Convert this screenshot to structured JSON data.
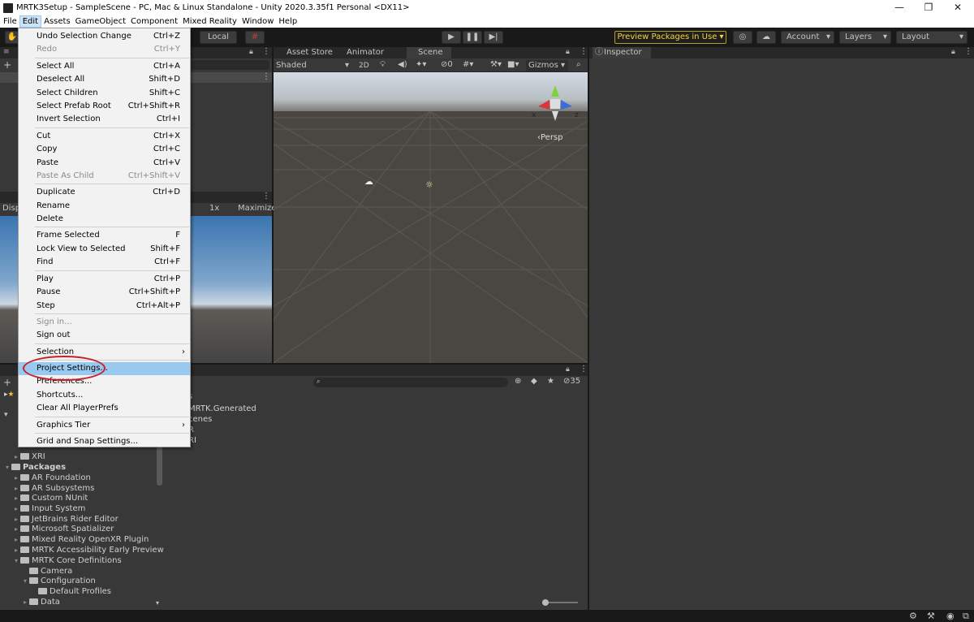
{
  "window": {
    "title": "MRTK3Setup - SampleScene - PC, Mac & Linux Standalone - Unity 2020.3.35f1 Personal <DX11>",
    "controls": [
      "—",
      "❐",
      "✕"
    ]
  },
  "menubar": [
    "File",
    "Edit",
    "Assets",
    "GameObject",
    "Component",
    "Mixed Reality",
    "Window",
    "Help"
  ],
  "toolbar": {
    "pivot_label": "Local",
    "preview_packages": "Preview Packages in Use ▾",
    "account": "Account",
    "layers": "Layers",
    "layout": "Layout"
  },
  "edit_menu": {
    "items": [
      {
        "label": "Undo Selection Change",
        "shortcut": "Ctrl+Z"
      },
      {
        "label": "Redo",
        "shortcut": "Ctrl+Y",
        "disabled": true
      },
      {
        "label": "Select All",
        "shortcut": "Ctrl+A"
      },
      {
        "label": "Deselect All",
        "shortcut": "Shift+D"
      },
      {
        "label": "Select Children",
        "shortcut": "Shift+C"
      },
      {
        "label": "Select Prefab Root",
        "shortcut": "Ctrl+Shift+R"
      },
      {
        "label": "Invert Selection",
        "shortcut": "Ctrl+I"
      },
      {
        "label": "Cut",
        "shortcut": "Ctrl+X"
      },
      {
        "label": "Copy",
        "shortcut": "Ctrl+C"
      },
      {
        "label": "Paste",
        "shortcut": "Ctrl+V"
      },
      {
        "label": "Paste As Child",
        "shortcut": "Ctrl+Shift+V",
        "disabled": true
      },
      {
        "label": "Duplicate",
        "shortcut": "Ctrl+D"
      },
      {
        "label": "Rename",
        "shortcut": ""
      },
      {
        "label": "Delete",
        "shortcut": ""
      },
      {
        "label": "Frame Selected",
        "shortcut": "F"
      },
      {
        "label": "Lock View to Selected",
        "shortcut": "Shift+F"
      },
      {
        "label": "Find",
        "shortcut": "Ctrl+F"
      },
      {
        "label": "Play",
        "shortcut": "Ctrl+P"
      },
      {
        "label": "Pause",
        "shortcut": "Ctrl+Shift+P"
      },
      {
        "label": "Step",
        "shortcut": "Ctrl+Alt+P"
      },
      {
        "label": "Sign in...",
        "shortcut": "",
        "disabled": true
      },
      {
        "label": "Sign out",
        "shortcut": ""
      },
      {
        "label": "Selection",
        "shortcut": ""
      },
      {
        "label": "Project Settings...",
        "shortcut": "",
        "highlighted": true
      },
      {
        "label": "Preferences...",
        "shortcut": ""
      },
      {
        "label": "Shortcuts...",
        "shortcut": ""
      },
      {
        "label": "Clear All PlayerPrefs",
        "shortcut": ""
      },
      {
        "label": "Graphics Tier",
        "shortcut": ""
      },
      {
        "label": "Grid and Snap Settings...",
        "shortcut": ""
      }
    ]
  },
  "scene": {
    "tabs": [
      "Asset Store",
      "Animator",
      "Scene"
    ],
    "shading": "Shaded",
    "mode_2d": "2D",
    "hidden_count": "0",
    "gizmos": "Gizmos",
    "persp": "‹Persp",
    "axis_x": "x",
    "axis_z": "z"
  },
  "game": {
    "disp": "Disp",
    "scale": "1x",
    "maximize": "Maximize"
  },
  "inspector": {
    "title": "Inspector"
  },
  "project": {
    "hidden_count": "35",
    "assets_header": "s",
    "asset_items": [
      "MRTK.Generated",
      "cenes",
      "R",
      "RI"
    ],
    "tree": [
      {
        "label": "XRI",
        "indent": 1,
        "expanded": false
      },
      {
        "label": "Packages",
        "indent": 0,
        "expanded": true,
        "bold": true
      },
      {
        "label": "AR Foundation",
        "indent": 1,
        "expanded": false
      },
      {
        "label": "AR Subsystems",
        "indent": 1,
        "expanded": false
      },
      {
        "label": "Custom NUnit",
        "indent": 1,
        "expanded": false
      },
      {
        "label": "Input System",
        "indent": 1,
        "expanded": false
      },
      {
        "label": "JetBrains Rider Editor",
        "indent": 1,
        "expanded": false
      },
      {
        "label": "Microsoft Spatializer",
        "indent": 1,
        "expanded": false
      },
      {
        "label": "Mixed Reality OpenXR Plugin",
        "indent": 1,
        "expanded": false
      },
      {
        "label": "MRTK Accessibility Early Preview",
        "indent": 1,
        "expanded": false
      },
      {
        "label": "MRTK Core Definitions",
        "indent": 1,
        "expanded": true
      },
      {
        "label": "Camera",
        "indent": 2,
        "expanded": null
      },
      {
        "label": "Configuration",
        "indent": 2,
        "expanded": true
      },
      {
        "label": "Default Profiles",
        "indent": 3,
        "expanded": null
      },
      {
        "label": "Data",
        "indent": 2,
        "expanded": false
      }
    ]
  }
}
